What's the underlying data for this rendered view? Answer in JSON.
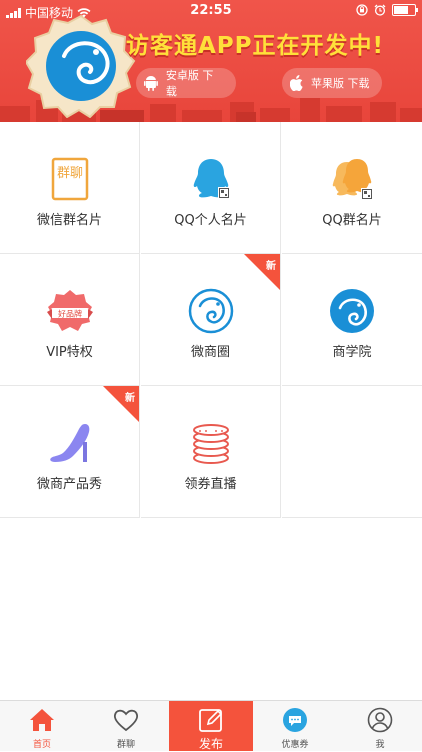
{
  "status_bar": {
    "carrier": "中国移动",
    "time": "22:55"
  },
  "banner": {
    "headline": "访客通APP正在开发中!",
    "android_button": "安卓版 下载",
    "ios_button": "苹果版 下载",
    "icons": {
      "android": "android-icon",
      "apple": "apple-icon"
    }
  },
  "grid": {
    "items": [
      {
        "label": "微信群名片",
        "icon": "wechat-group-card-icon",
        "icon_text": "群聊"
      },
      {
        "label": "QQ个人名片",
        "icon": "qq-personal-card-icon"
      },
      {
        "label": "QQ群名片",
        "icon": "qq-group-card-icon"
      },
      {
        "label": "VIP特权",
        "icon": "vip-badge-icon",
        "icon_text": "好品牌"
      },
      {
        "label": "微商圈",
        "icon": "wechat-circle-icon",
        "badge": "新"
      },
      {
        "label": "商学院",
        "icon": "business-school-icon"
      },
      {
        "label": "微商产品秀",
        "icon": "high-heel-icon"
      },
      {
        "label": "领券直播",
        "icon": "coin-stack-icon",
        "badge": "新"
      }
    ]
  },
  "tabbar": {
    "items": [
      {
        "label": "首页",
        "icon": "home-icon",
        "active": true
      },
      {
        "label": "群聊",
        "icon": "heart-icon"
      },
      {
        "label": "发布",
        "icon": "edit-icon"
      },
      {
        "label": "优惠券",
        "icon": "chat-bubble-icon"
      },
      {
        "label": "我",
        "icon": "profile-icon"
      }
    ]
  },
  "colors": {
    "banner_red": "#e8453b",
    "accent_orange": "#f4533c",
    "headline_yellow": "#ffe03a",
    "qq_blue": "#2aa4e0",
    "qq_orange": "#f5a53a",
    "icon_blue": "#1a8fd6",
    "shoe_purple": "#8b86f0"
  }
}
